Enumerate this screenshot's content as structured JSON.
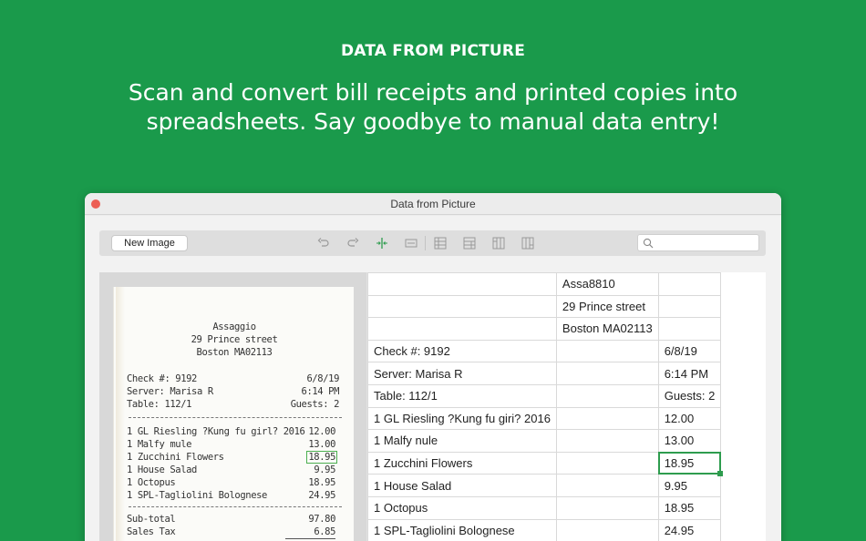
{
  "promo": {
    "headline": "DATA FROM PICTURE",
    "subline": "Scan and convert bill receipts and printed copies into spreadsheets. Say goodbye to manual data entry!"
  },
  "window": {
    "title": "Data from Picture"
  },
  "toolbar": {
    "new_image_label": "New Image",
    "tools": [
      "undo-icon",
      "redo-icon",
      "split-column-icon",
      "merge-icon",
      "insert-row-above-icon",
      "insert-row-below-icon",
      "insert-column-left-icon",
      "insert-column-right-icon"
    ],
    "search_placeholder": ""
  },
  "receipt": {
    "header": [
      "Assaggio",
      "29 Prince street",
      "Boston MA02113"
    ],
    "info": [
      {
        "left": "Check #: 9192",
        "right": "6/8/19"
      },
      {
        "left": "Server: Marisa R",
        "right": "6:14 PM"
      },
      {
        "left": "Table: 112/1",
        "right": "Guests: 2"
      }
    ],
    "items": [
      {
        "left": "1 GL Riesling ?Kung fu girl? 2016",
        "right": "12.00"
      },
      {
        "left": "1 Malfy mule",
        "right": "13.00"
      },
      {
        "left": "1 Zucchini Flowers",
        "right": "18.95"
      },
      {
        "left": "1 House Salad",
        "right": "9.95"
      },
      {
        "left": "1 Octopus",
        "right": "18.95"
      },
      {
        "left": "1 SPL-Tagliolini Bolognese",
        "right": "24.95"
      }
    ],
    "totals": [
      {
        "left": "Sub-total",
        "right": "97.80"
      },
      {
        "left": "Sales Tax",
        "right": "6.85"
      }
    ]
  },
  "sheet": {
    "rows": [
      [
        "",
        "Assa8810",
        ""
      ],
      [
        "",
        "29 Prince street",
        ""
      ],
      [
        "",
        "Boston MA02113",
        ""
      ],
      [
        "Check #: 9192",
        "",
        "6/8/19"
      ],
      [
        "Server: Marisa R",
        "",
        "6:14 PM"
      ],
      [
        "Table: 112/1",
        "",
        "Guests: 2"
      ],
      [
        "1 GL Riesling ?Kung fu giri? 2016",
        "",
        "12.00"
      ],
      [
        "1 Malfy nule",
        "",
        "13.00"
      ],
      [
        "1 Zucchini Flowers",
        "",
        "18.95"
      ],
      [
        "1 House Salad",
        "",
        "9.95"
      ],
      [
        "1 Octopus",
        "",
        "18.95"
      ],
      [
        "1 SPL-Tagliolini Bolognese",
        "",
        "24.95"
      ]
    ],
    "selected_value": "18.95"
  },
  "colors": {
    "background": "#1a9a4b",
    "selection": "#2e9c4e",
    "close_button": "#ec5f55"
  }
}
